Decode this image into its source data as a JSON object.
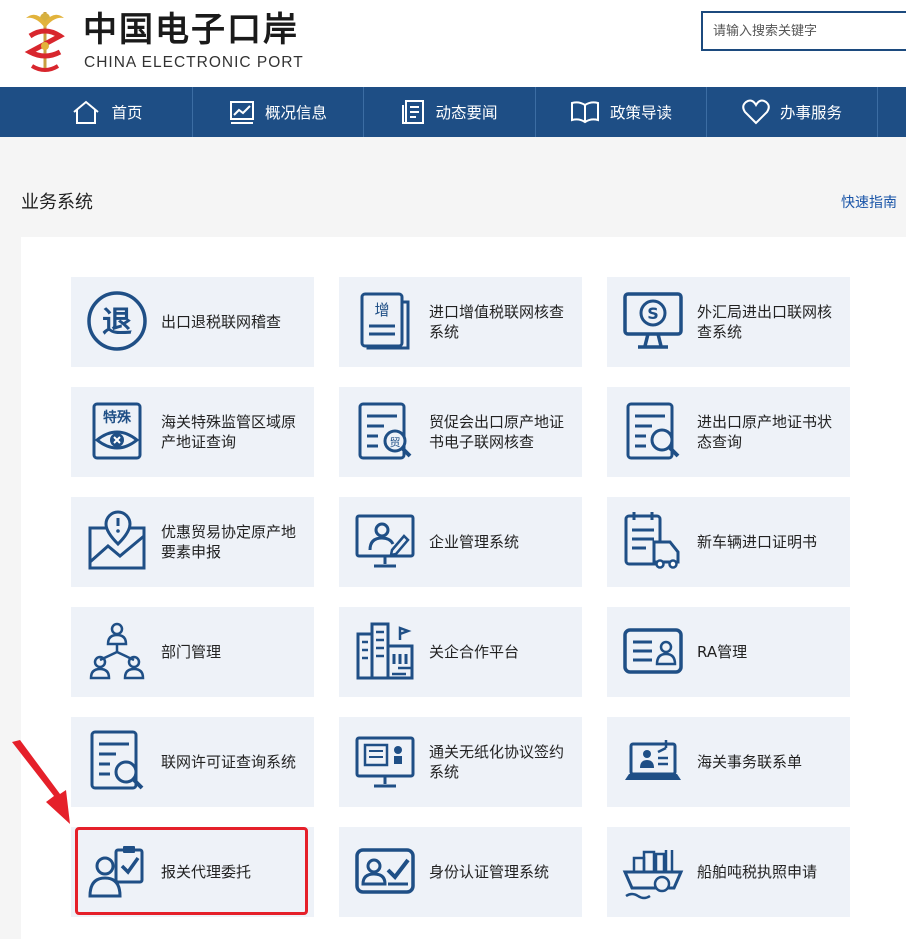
{
  "header": {
    "logo_cn": "中国电子口岸",
    "logo_en": "CHINA ELECTRONIC PORT",
    "search_placeholder": "请输入搜索关键字"
  },
  "nav": [
    {
      "label": "首页",
      "icon": "home-icon"
    },
    {
      "label": "概况信息",
      "icon": "chart-icon"
    },
    {
      "label": "动态要闻",
      "icon": "news-icon"
    },
    {
      "label": "政策导读",
      "icon": "book-icon"
    },
    {
      "label": "办事服务",
      "icon": "heart-icon"
    }
  ],
  "section": {
    "title": "业务系统",
    "quick_guide": "快速指南"
  },
  "cards": [
    {
      "label": "出口退税联网稽查",
      "icon": "tax-refund-icon"
    },
    {
      "label": "进口增值税联网核查系统",
      "icon": "vat-document-icon"
    },
    {
      "label": "外汇局进出口联网核查系统",
      "icon": "forex-monitor-icon"
    },
    {
      "label": "海关特殊监管区域原产地证查询",
      "icon": "special-zone-eye-icon"
    },
    {
      "label": "贸促会出口原产地证书电子联网核查",
      "icon": "trade-certificate-icon"
    },
    {
      "label": "进出口原产地证书状态查询",
      "icon": "certificate-search-icon"
    },
    {
      "label": "优惠贸易协定原产地要素申报",
      "icon": "map-pin-icon"
    },
    {
      "label": "企业管理系统",
      "icon": "enterprise-monitor-icon"
    },
    {
      "label": "新车辆进口证明书",
      "icon": "vehicle-document-icon"
    },
    {
      "label": "部门管理",
      "icon": "org-chart-icon"
    },
    {
      "label": "关企合作平台",
      "icon": "buildings-icon"
    },
    {
      "label": "RA管理",
      "icon": "id-card-icon"
    },
    {
      "label": "联网许可证查询系统",
      "icon": "license-search-icon"
    },
    {
      "label": "通关无纸化协议签约系统",
      "icon": "paperless-monitor-icon"
    },
    {
      "label": "海关事务联系单",
      "icon": "laptop-contact-icon"
    },
    {
      "label": "报关代理委托",
      "icon": "agent-clipboard-icon"
    },
    {
      "label": "身份认证管理系统",
      "icon": "identity-check-icon"
    },
    {
      "label": "船舶吨税执照申请",
      "icon": "ship-icon"
    }
  ],
  "colors": {
    "nav_bg": "#1e4e85",
    "icon": "#1f4f86",
    "card_bg": "#eef2f8",
    "highlight": "#e5202a",
    "link": "#1a55a8"
  }
}
